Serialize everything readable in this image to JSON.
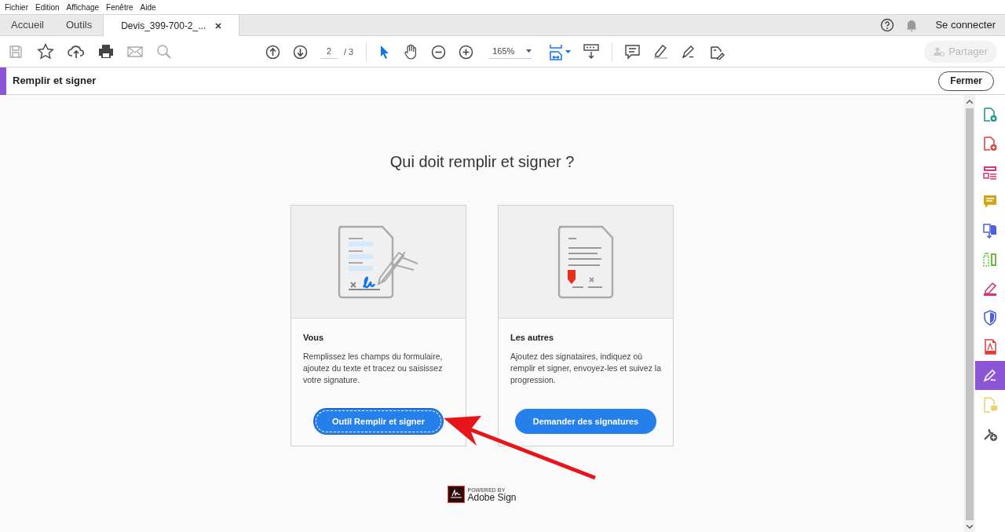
{
  "menu_bar": [
    "Fichier",
    "Edition",
    "Affichage",
    "Fenêtre",
    "Aide"
  ],
  "tabs": [
    {
      "label": "Accueil",
      "selected": false,
      "kind": "nav"
    },
    {
      "label": "Outils",
      "selected": false,
      "kind": "nav"
    },
    {
      "label": "Devis_399-700-2_...",
      "selected": true,
      "kind": "document"
    }
  ],
  "header_right": {
    "sign_in": "Se connecter"
  },
  "toolbar": {
    "page": "2",
    "page_total": "/ 3",
    "zoom": "165%",
    "share": "Partager"
  },
  "panel": {
    "title": "Remplir et signer",
    "close": "Fermer"
  },
  "main": {
    "heading": "Qui doit remplir et signer ?",
    "cards": [
      {
        "kind": "self",
        "title": "Vous",
        "text": "Remplissez les champs du formulaire, ajoutez du texte et tracez ou saisissez votre signature.",
        "button": "Outil Remplir et signer",
        "focused": true
      },
      {
        "kind": "others",
        "title": "Les autres",
        "text": "Ajoutez des signataires, indiquez où remplir et signer, envoyez-les et suivez la progression.",
        "button": "Demander des signatures",
        "focused": false
      }
    ],
    "footer": {
      "powered": "POWERED BY",
      "brand": "Adobe Sign"
    }
  },
  "sidebar": {
    "items": [
      {
        "kind": "doc-plus",
        "color": "#1e8f8c",
        "selected": false
      },
      {
        "kind": "doc-plus",
        "color": "#e03b3b",
        "selected": false
      },
      {
        "kind": "layout",
        "color": "#d9347a",
        "selected": false
      },
      {
        "kind": "comment",
        "color": "#d4a514",
        "selected": false
      },
      {
        "kind": "doc-arrow",
        "color": "#4b5fe0",
        "selected": false
      },
      {
        "kind": "compare",
        "color": "#6cbd3b",
        "selected": false
      },
      {
        "kind": "highlighter",
        "color": "#d9347a",
        "selected": false
      },
      {
        "kind": "shield",
        "color": "#4b5fe0",
        "selected": false
      },
      {
        "kind": "doc",
        "color": "#e03b3b",
        "selected": false
      },
      {
        "kind": "pen",
        "color": "#ffffff",
        "selected": true
      },
      {
        "kind": "doc-comment",
        "color": "#e8d36a",
        "selected": false
      },
      {
        "kind": "wrench",
        "color": "#555555",
        "selected": false
      }
    ]
  }
}
